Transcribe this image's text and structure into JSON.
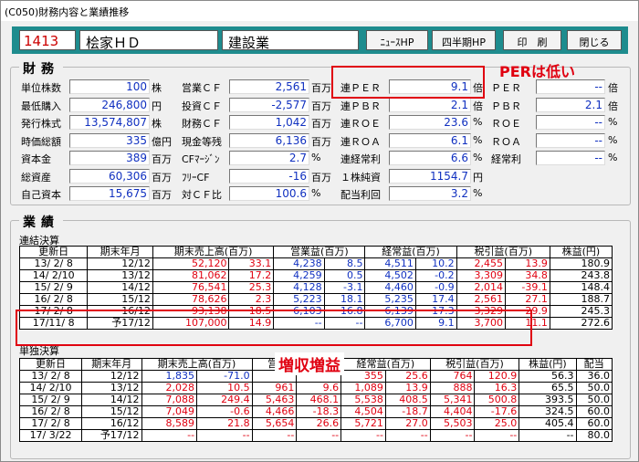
{
  "window": {
    "title": "(C050)財務内容と業績推移"
  },
  "header": {
    "code": "1413",
    "company": "桧家ＨＤ",
    "industry": "建設業",
    "buttons": [
      "ﾆｭｰｽHP",
      "四半期HP",
      "印　刷",
      "閉じる"
    ]
  },
  "finance": {
    "title": "財務",
    "col1": [
      {
        "label": "単位株数",
        "value": "100",
        "unit": "株"
      },
      {
        "label": "最低購入",
        "value": "246,800",
        "unit": "円"
      },
      {
        "label": "発行株式",
        "value": "13,574,807",
        "unit": "株"
      },
      {
        "label": "時価総額",
        "value": "335",
        "unit": "億円"
      },
      {
        "label": "資本金",
        "value": "389",
        "unit": "百万"
      },
      {
        "label": "総資産",
        "value": "60,306",
        "unit": "百万"
      },
      {
        "label": "自己資本",
        "value": "15,675",
        "unit": "百万"
      }
    ],
    "col2": [
      {
        "label": "営業ＣＦ",
        "value": "2,561",
        "unit": "百万"
      },
      {
        "label": "投資ＣＦ",
        "value": "-2,577",
        "unit": "百万"
      },
      {
        "label": "財務ＣＦ",
        "value": "1,042",
        "unit": "百万"
      },
      {
        "label": "現金等残",
        "value": "6,136",
        "unit": "百万"
      },
      {
        "label": "CFﾏｰｼﾞﾝ",
        "value": "2.7",
        "unit": "%"
      },
      {
        "label": "ﾌﾘｰCF",
        "value": "-16",
        "unit": "百万"
      },
      {
        "label": "対ＣＦ比",
        "value": "100.6",
        "unit": "%"
      }
    ],
    "col3": [
      {
        "label": "連ＰＥＲ",
        "value": "9.1",
        "unit": "倍"
      },
      {
        "label": "連ＰＢＲ",
        "value": "2.1",
        "unit": "倍"
      },
      {
        "label": "連ＲＯＥ",
        "value": "23.6",
        "unit": "%"
      },
      {
        "label": "連ＲＯＡ",
        "value": "6.1",
        "unit": "%"
      },
      {
        "label": "連経常利",
        "value": "6.6",
        "unit": "%"
      },
      {
        "label": "１株純資",
        "value": "1154.7",
        "unit": "円"
      },
      {
        "label": "配当利回",
        "value": "3.2",
        "unit": "%"
      }
    ],
    "col4": [
      {
        "label": "ＰＥＲ",
        "value": "--",
        "unit": "倍"
      },
      {
        "label": "ＰＢＲ",
        "value": "2.1",
        "unit": "倍"
      },
      {
        "label": "ＲＯＥ",
        "value": "--",
        "unit": "%"
      },
      {
        "label": "ＲＯＡ",
        "value": "--",
        "unit": "%"
      },
      {
        "label": "経常利",
        "value": "--",
        "unit": "%"
      }
    ]
  },
  "results": {
    "title": "業績",
    "consolidated_label": "連結決算",
    "single_label": "単独決算",
    "headers1": [
      "更新日",
      "期末年月",
      "期末売上高(百万)",
      "営業益(百万)",
      "経常益(百万)",
      "税引益(百万)",
      "株益(円)"
    ],
    "rows1": [
      [
        "13/ 2/ 8",
        "12/12",
        "52,120",
        "33.1",
        "4,238",
        "8.5",
        "4,511",
        "10.2",
        "2,455",
        "13.9",
        "180.9"
      ],
      [
        "14/ 2/10",
        "13/12",
        "81,062",
        "17.2",
        "4,259",
        "0.5",
        "4,502",
        "-0.2",
        "3,309",
        "34.8",
        "243.8"
      ],
      [
        "15/ 2/ 9",
        "14/12",
        "76,541",
        "25.3",
        "4,128",
        "-3.1",
        "4,460",
        "-0.9",
        "2,014",
        "-39.1",
        "148.4"
      ],
      [
        "16/ 2/ 8",
        "15/12",
        "78,626",
        "2.3",
        "5,223",
        "18.1",
        "5,235",
        "17.4",
        "2,561",
        "27.1",
        "188.7"
      ],
      [
        "17/ 2/ 8",
        "16/12",
        "93,138",
        "18.5",
        "6,103",
        "16.8",
        "6,139",
        "17.3",
        "3,329",
        "29.9",
        "245.3"
      ],
      [
        "17/11/ 8",
        "予17/12",
        "107,000",
        "14.9",
        "--",
        "--",
        "6,700",
        "9.1",
        "3,700",
        "11.1",
        "272.6"
      ]
    ],
    "headers2": [
      "更新日",
      "期末年月",
      "期末売上高(百万)",
      "営業益(百万)",
      "経常益(百万)",
      "税引益(百万)",
      "株益(円)",
      "配当"
    ],
    "rows2": [
      [
        "13/ 2/ 8",
        "12/12",
        "1,835",
        "-71.0",
        "",
        "",
        "355",
        "25.6",
        "764",
        "120.9",
        "56.3",
        "36.0"
      ],
      [
        "14/ 2/10",
        "13/12",
        "2,028",
        "10.5",
        "961",
        "9.6",
        "1,089",
        "13.9",
        "888",
        "16.3",
        "65.5",
        "50.0"
      ],
      [
        "15/ 2/ 9",
        "14/12",
        "7,088",
        "249.4",
        "5,463",
        "468.1",
        "5,538",
        "408.5",
        "5,341",
        "500.8",
        "393.5",
        "50.0"
      ],
      [
        "16/ 2/ 8",
        "15/12",
        "7,049",
        "-0.6",
        "4,466",
        "-18.3",
        "4,504",
        "-18.7",
        "4,404",
        "-17.6",
        "324.5",
        "60.0"
      ],
      [
        "17/ 2/ 8",
        "16/12",
        "8,589",
        "21.8",
        "5,654",
        "26.6",
        "5,721",
        "27.0",
        "5,503",
        "25.0",
        "405.4",
        "60.0"
      ],
      [
        "17/ 3/22",
        "予17/12",
        "--",
        "--",
        "--",
        "--",
        "--",
        "--",
        "--",
        "--",
        "--",
        "80.0"
      ]
    ]
  },
  "annotations": {
    "per": "PERは低い",
    "growth": "増収増益"
  }
}
